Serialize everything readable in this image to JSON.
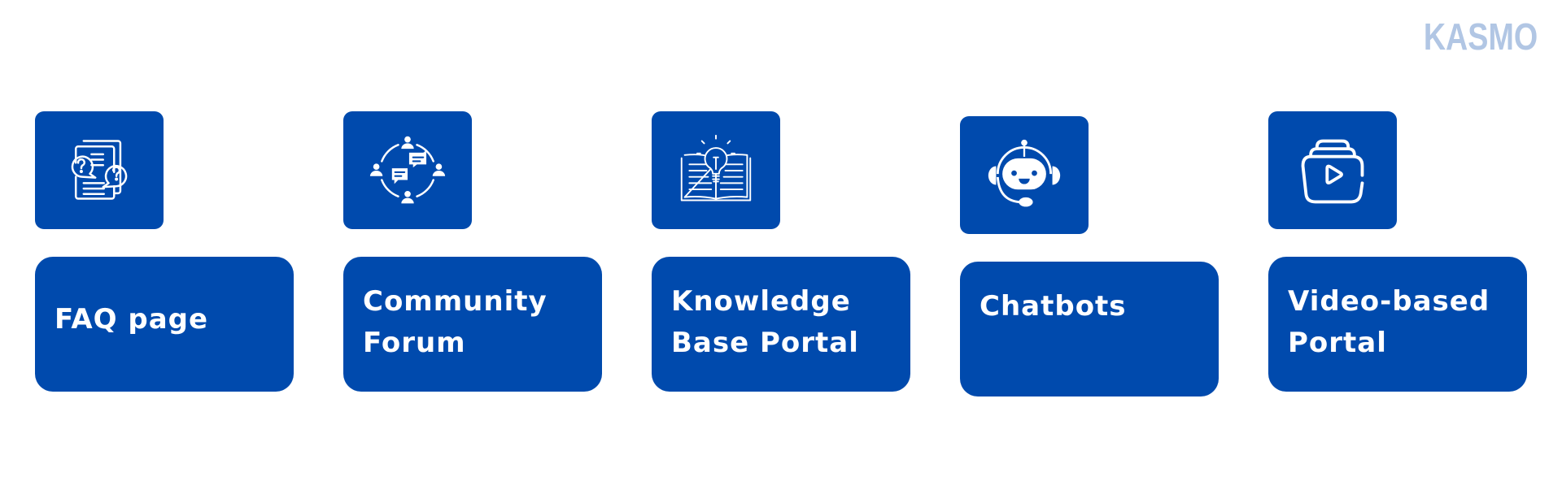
{
  "brand": {
    "logo_text": "KASMO",
    "logo_color": "#b1c6e4"
  },
  "theme": {
    "box_color": "#004aad",
    "text_color": "#ffffff"
  },
  "items": [
    {
      "icon": "faq-document-icon",
      "label_lines": [
        "FAQ page"
      ]
    },
    {
      "icon": "community-forum-icon",
      "label_lines": [
        "Community",
        "Forum"
      ]
    },
    {
      "icon": "knowledge-book-lightbulb-icon",
      "label_lines": [
        "Knowledge",
        "Base Portal"
      ]
    },
    {
      "icon": "chatbot-headset-icon",
      "label_lines": [
        "Chatbots"
      ]
    },
    {
      "icon": "video-library-play-icon",
      "label_lines": [
        "Video-based",
        "Portal"
      ]
    }
  ]
}
